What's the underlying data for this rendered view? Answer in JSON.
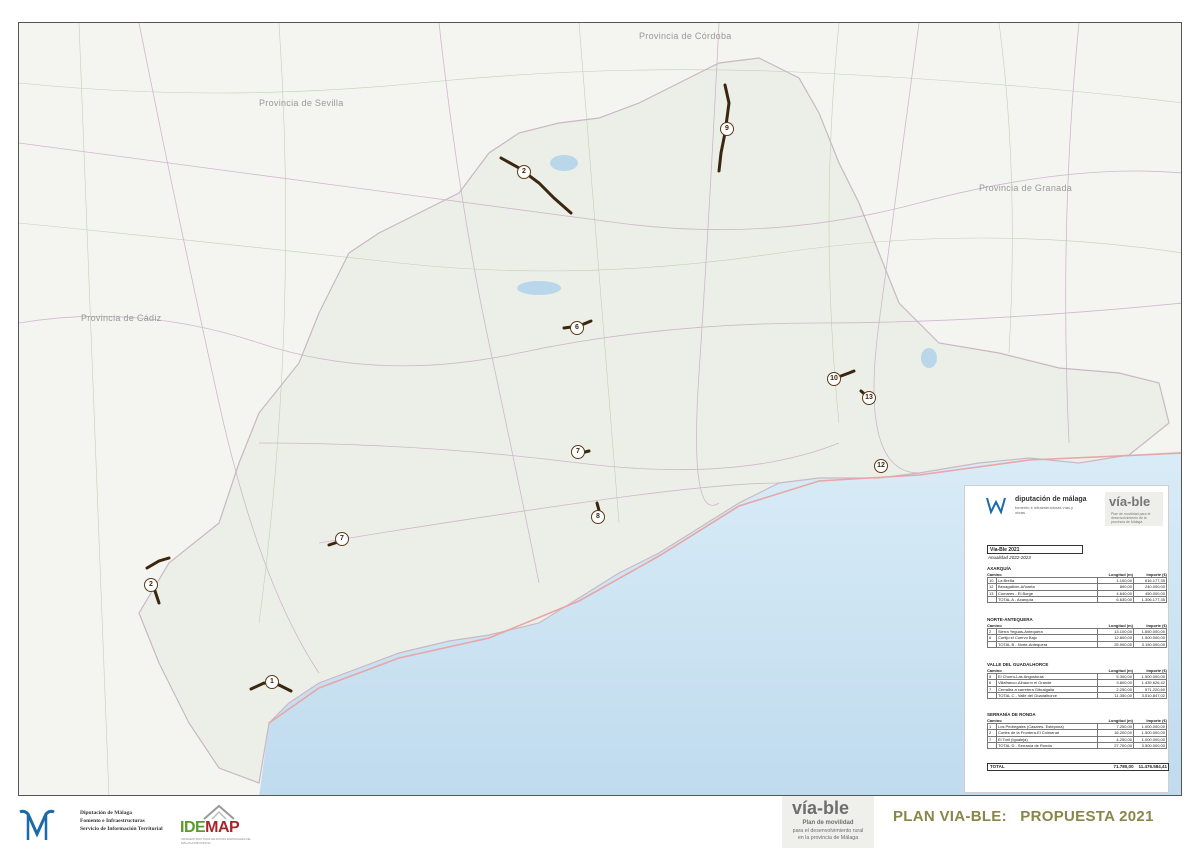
{
  "map": {
    "place_labels": {
      "provincia_cordoba": "Provincia de Córdoba",
      "provincia_sevilla": "Provincia de Sevilla",
      "provincia_granada": "Provincia de Granada",
      "provincia_cadiz": "Provincia de Cádiz"
    },
    "route_markers": [
      "1",
      "2",
      "6",
      "7",
      "8",
      "9",
      "10",
      "12",
      "13",
      "2",
      "7"
    ]
  },
  "legend": {
    "org_name": "diputación de málaga",
    "org_sub": "fomento e infraestructuras vías y obras",
    "via_ble_word": "vía-ble",
    "via_ble_sub": "Plan de movilidad para el desenvolvimiento de la provincia de Málaga",
    "title": "Vía-Ble 2021",
    "subtitle": "Anualidad 2022-2023",
    "col_camino": "Camino",
    "col_longitud": "Longitud (m)",
    "col_importe": "Importe (€)",
    "sections": [
      {
        "title": "AXARQUÍA",
        "rows": [
          {
            "n": "10",
            "camino": "La Breña",
            "longitud": "1.100,00",
            "importe": "616.177,35"
          },
          {
            "n": "12",
            "camino": "Benagalbón-Añoreta",
            "longitud": "890,00",
            "importe": "240.000,00"
          },
          {
            "n": "13",
            "camino": "Comares - El Borge",
            "longitud": "4.640,00",
            "importe": "450.000,00"
          }
        ],
        "total": {
          "label": "TOTAL A - Axarquía",
          "longitud": "6.630,00",
          "importe": "1.306.177,35"
        }
      },
      {
        "title": "NORTE-ANTEQUERA",
        "rows": [
          {
            "n": "2",
            "camino": "Sierra Yeguas-Antequera",
            "longitud": "13.100,00",
            "importe": "1.650.000,00"
          },
          {
            "n": "6",
            "camino": "Cortijo el Cuervo Bajo",
            "longitud": "12.800,00",
            "importe": "1.500.000,00"
          }
        ],
        "total": {
          "label": "TOTAL B - Norte-Antequera",
          "longitud": "25.900,00",
          "importe": "3.150.000,00"
        }
      },
      {
        "title": "VALLE DEL GUADALHORCE",
        "rows": [
          {
            "n": "5",
            "camino": "El Chorro-Las Angosturas",
            "longitud": "5.300,00",
            "importe": "1.500.000,00"
          },
          {
            "n": "6",
            "camino": "Villafranco-Alhaurín el Grande",
            "longitud": "3.800,00",
            "importe": "1.439.626,42"
          },
          {
            "n": "7",
            "camino": "Cerralba a carretera Gibralgalia",
            "longitud": "2.250,00",
            "importe": "571.220,60"
          }
        ],
        "total": {
          "label": "TOTAL C - Valle del Guadalhorce",
          "longitud": "11.350,00",
          "importe": "3.510.847,02"
        }
      },
      {
        "title": "SERRANÍA DE RONDA",
        "rows": [
          {
            "n": "1",
            "camino": "Los Pedregales (Casares- Estepona)",
            "longitud": "7.250,00",
            "importe": "1.000.000,00"
          },
          {
            "n": "2",
            "camino": "Cortes de la Frontera-El Colmenar",
            "longitud": "16.200,00",
            "importe": "1.500.000,00"
          },
          {
            "n": "7",
            "camino": "El Toril (Igualeja)",
            "longitud": "4.250,00",
            "importe": "1.000.000,00"
          }
        ],
        "total": {
          "label": "TOTAL D - Serranía de Ronda",
          "longitud": "27.700,00",
          "importe": "3.500.000,00"
        }
      }
    ],
    "grand_total": {
      "label": "TOTAL",
      "longitud": "71.780,00",
      "importe": "11.476.584,41"
    }
  },
  "footer": {
    "org_line1": "Diputación de Málaga",
    "org_line2": "Fomento e Infraestructuras",
    "org_line3": "Servicio de Información Territorial",
    "idemap_word_a": "IDE",
    "idemap_word_b": "MAP",
    "idemap_sub": "INFRAESTRUCTURA DE DATOS ESPACIALES DE MÁLAGA PROVINCIA",
    "via_word": "vía-ble",
    "via_plan": "Plan de movilidad",
    "via_sub1": "para el desenvolvimiento rural",
    "via_sub2": "en la provincia de Málaga",
    "title": "PLAN VIA-BLE:   PROPUESTA 2021"
  },
  "colors": {
    "sea": "#cfe5f3",
    "land": "#f1f1ec",
    "route": "#3b2610",
    "footer_title": "#8a8548"
  }
}
